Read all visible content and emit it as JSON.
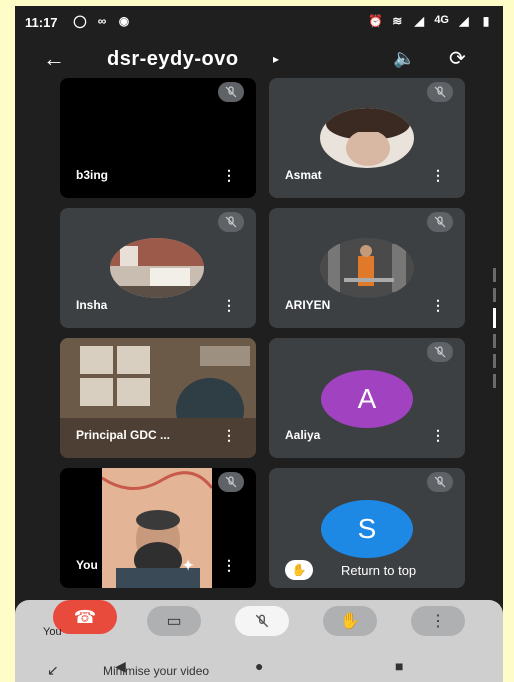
{
  "status": {
    "time": "11:17",
    "network": "4G"
  },
  "meeting": {
    "code": "dsr-eydy-ovo"
  },
  "tiles": [
    {
      "name": "b3ing"
    },
    {
      "name": "Asmat"
    },
    {
      "name": "Insha"
    },
    {
      "name": "ARIYEN"
    },
    {
      "name": "Principal GDC ..."
    },
    {
      "name": "Aaliya",
      "avatar_letter": "A",
      "avatar_color": "#a142c0"
    },
    {
      "name": "You"
    },
    {
      "avatar_letter": "S",
      "avatar_color": "#1e88e5"
    }
  ],
  "return_to_top": "Return to top",
  "toolbar": {
    "you_label": "You"
  },
  "minimise_label": "Minimise your video"
}
